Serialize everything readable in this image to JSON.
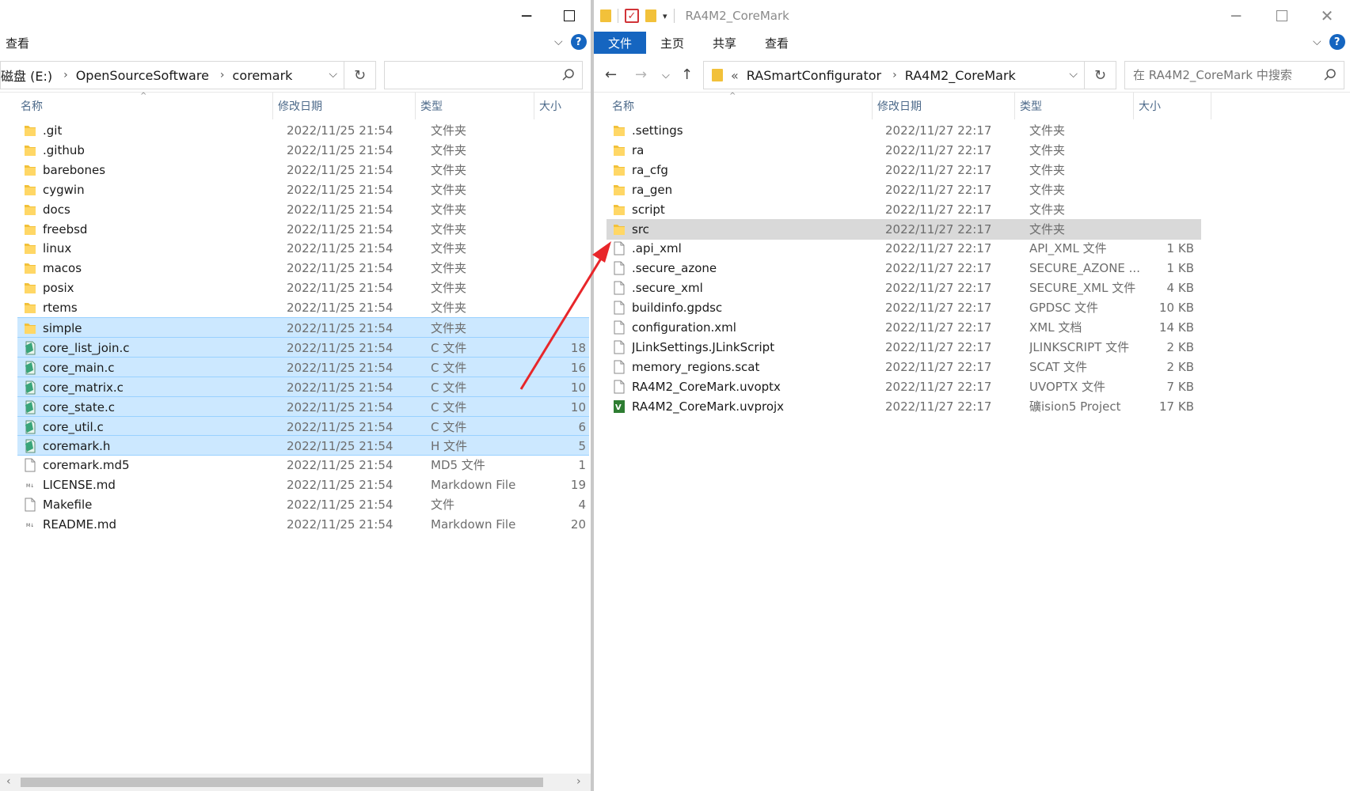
{
  "left": {
    "ribbon": {
      "view_label": "查看"
    },
    "address": {
      "crumbs": [
        "磁盘 (E:)",
        "OpenSourceSoftware",
        "coremark"
      ]
    },
    "search": {
      "placeholder": ""
    },
    "columns": {
      "name": "名称",
      "date": "修改日期",
      "type": "类型",
      "size": "大小"
    },
    "rows": [
      {
        "name": ".git",
        "date": "2022/11/25 21:54",
        "type": "文件夹",
        "size": "",
        "icon": "folder-icon",
        "state": ""
      },
      {
        "name": ".github",
        "date": "2022/11/25 21:54",
        "type": "文件夹",
        "size": "",
        "icon": "folder-icon",
        "state": ""
      },
      {
        "name": "barebones",
        "date": "2022/11/25 21:54",
        "type": "文件夹",
        "size": "",
        "icon": "folder-icon",
        "state": ""
      },
      {
        "name": "cygwin",
        "date": "2022/11/25 21:54",
        "type": "文件夹",
        "size": "",
        "icon": "folder-icon",
        "state": ""
      },
      {
        "name": "docs",
        "date": "2022/11/25 21:54",
        "type": "文件夹",
        "size": "",
        "icon": "folder-icon",
        "state": ""
      },
      {
        "name": "freebsd",
        "date": "2022/11/25 21:54",
        "type": "文件夹",
        "size": "",
        "icon": "folder-icon",
        "state": ""
      },
      {
        "name": "linux",
        "date": "2022/11/25 21:54",
        "type": "文件夹",
        "size": "",
        "icon": "folder-icon",
        "state": ""
      },
      {
        "name": "macos",
        "date": "2022/11/25 21:54",
        "type": "文件夹",
        "size": "",
        "icon": "folder-icon",
        "state": ""
      },
      {
        "name": "posix",
        "date": "2022/11/25 21:54",
        "type": "文件夹",
        "size": "",
        "icon": "folder-icon",
        "state": ""
      },
      {
        "name": "rtems",
        "date": "2022/11/25 21:54",
        "type": "文件夹",
        "size": "",
        "icon": "folder-icon",
        "state": ""
      },
      {
        "name": "simple",
        "date": "2022/11/25 21:54",
        "type": "文件夹",
        "size": "",
        "icon": "folder-icon",
        "state": "selected"
      },
      {
        "name": "core_list_join.c",
        "date": "2022/11/25 21:54",
        "type": "C 文件",
        "size": "18",
        "icon": "c-source-icon",
        "state": "selected"
      },
      {
        "name": "core_main.c",
        "date": "2022/11/25 21:54",
        "type": "C 文件",
        "size": "16",
        "icon": "c-source-icon",
        "state": "selected"
      },
      {
        "name": "core_matrix.c",
        "date": "2022/11/25 21:54",
        "type": "C 文件",
        "size": "10",
        "icon": "c-source-icon",
        "state": "selected"
      },
      {
        "name": "core_state.c",
        "date": "2022/11/25 21:54",
        "type": "C 文件",
        "size": "10",
        "icon": "c-source-icon",
        "state": "selected"
      },
      {
        "name": "core_util.c",
        "date": "2022/11/25 21:54",
        "type": "C 文件",
        "size": "6",
        "icon": "c-source-icon",
        "state": "selected"
      },
      {
        "name": "coremark.h",
        "date": "2022/11/25 21:54",
        "type": "H 文件",
        "size": "5",
        "icon": "c-source-icon",
        "state": "selected"
      },
      {
        "name": "coremark.md5",
        "date": "2022/11/25 21:54",
        "type": "MD5 文件",
        "size": "1",
        "icon": "file-icon",
        "state": ""
      },
      {
        "name": "LICENSE.md",
        "date": "2022/11/25 21:54",
        "type": "Markdown File",
        "size": "19",
        "icon": "markdown-icon",
        "state": ""
      },
      {
        "name": "Makefile",
        "date": "2022/11/25 21:54",
        "type": "文件",
        "size": "4",
        "icon": "file-icon",
        "state": ""
      },
      {
        "name": "README.md",
        "date": "2022/11/25 21:54",
        "type": "Markdown File",
        "size": "20",
        "icon": "markdown-icon",
        "state": ""
      }
    ]
  },
  "right": {
    "window_title": "RA4M2_CoreMark",
    "ribbon": {
      "tabs": [
        "文件",
        "主页",
        "共享",
        "查看"
      ]
    },
    "address": {
      "overflow": "«",
      "crumbs": [
        "RASmartConfigurator",
        "RA4M2_CoreMark"
      ]
    },
    "search": {
      "placeholder": "在 RA4M2_CoreMark 中搜索"
    },
    "columns": {
      "name": "名称",
      "date": "修改日期",
      "type": "类型",
      "size": "大小"
    },
    "rows": [
      {
        "name": ".settings",
        "date": "2022/11/27 22:17",
        "type": "文件夹",
        "size": "",
        "icon": "folder-icon",
        "state": ""
      },
      {
        "name": "ra",
        "date": "2022/11/27 22:17",
        "type": "文件夹",
        "size": "",
        "icon": "folder-icon",
        "state": ""
      },
      {
        "name": "ra_cfg",
        "date": "2022/11/27 22:17",
        "type": "文件夹",
        "size": "",
        "icon": "folder-icon",
        "state": ""
      },
      {
        "name": "ra_gen",
        "date": "2022/11/27 22:17",
        "type": "文件夹",
        "size": "",
        "icon": "folder-icon",
        "state": ""
      },
      {
        "name": "script",
        "date": "2022/11/27 22:17",
        "type": "文件夹",
        "size": "",
        "icon": "folder-icon",
        "state": ""
      },
      {
        "name": "src",
        "date": "2022/11/27 22:17",
        "type": "文件夹",
        "size": "",
        "icon": "folder-icon",
        "state": "hover"
      },
      {
        "name": ".api_xml",
        "date": "2022/11/27 22:17",
        "type": "API_XML 文件",
        "size": "1 KB",
        "icon": "file-icon",
        "state": ""
      },
      {
        "name": ".secure_azone",
        "date": "2022/11/27 22:17",
        "type": "SECURE_AZONE ...",
        "size": "1 KB",
        "icon": "file-icon",
        "state": ""
      },
      {
        "name": ".secure_xml",
        "date": "2022/11/27 22:17",
        "type": "SECURE_XML 文件",
        "size": "4 KB",
        "icon": "file-icon",
        "state": ""
      },
      {
        "name": "buildinfo.gpdsc",
        "date": "2022/11/27 22:17",
        "type": "GPDSC 文件",
        "size": "10 KB",
        "icon": "file-icon",
        "state": ""
      },
      {
        "name": "configuration.xml",
        "date": "2022/11/27 22:17",
        "type": "XML 文档",
        "size": "14 KB",
        "icon": "file-icon",
        "state": ""
      },
      {
        "name": "JLinkSettings.JLinkScript",
        "date": "2022/11/27 22:17",
        "type": "JLINKSCRIPT 文件",
        "size": "2 KB",
        "icon": "file-icon",
        "state": ""
      },
      {
        "name": "memory_regions.scat",
        "date": "2022/11/27 22:17",
        "type": "SCAT 文件",
        "size": "2 KB",
        "icon": "file-icon",
        "state": ""
      },
      {
        "name": "RA4M2_CoreMark.uvoptx",
        "date": "2022/11/27 22:17",
        "type": "UVOPTX 文件",
        "size": "7 KB",
        "icon": "file-icon",
        "state": ""
      },
      {
        "name": "RA4M2_CoreMark.uvprojx",
        "date": "2022/11/27 22:17",
        "type": "礦ision5 Project",
        "size": "17 KB",
        "icon": "keil-project-icon",
        "state": ""
      }
    ]
  },
  "colors": {
    "accent": "#1565c0",
    "selection": "#cce8ff",
    "hover": "#d9d9d9",
    "folder": "#f2c13a",
    "arrow": "#e8262a"
  }
}
